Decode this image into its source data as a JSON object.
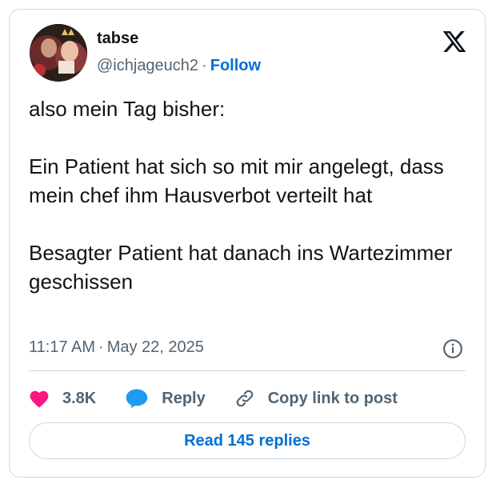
{
  "author": {
    "name": "tabse",
    "handle": "@ichjageuch2",
    "separator": "·",
    "follow_label": "Follow"
  },
  "tweet": {
    "paragraphs": [
      "also mein Tag bisher:",
      "",
      "Ein Patient hat sich so mit mir angelegt, dass mein chef ihm Hausverbot verteilt hat",
      "",
      "Besagter Patient hat danach ins Wartezimmer geschissen"
    ],
    "time": "11:17 AM",
    "separator": "·",
    "date": "May 22, 2025"
  },
  "actions": {
    "like_count": "3.8K",
    "reply_label": "Reply",
    "copy_label": "Copy link to post"
  },
  "read_replies_label": "Read 145 replies",
  "colors": {
    "accent": "#006fd6",
    "like": "#f91880",
    "reply_bubble": "#1d9bf0",
    "muted": "#536471",
    "border": "#cfd9de"
  },
  "icons": [
    "x-logo-icon",
    "info-icon",
    "heart-icon",
    "reply-icon",
    "link-icon"
  ]
}
